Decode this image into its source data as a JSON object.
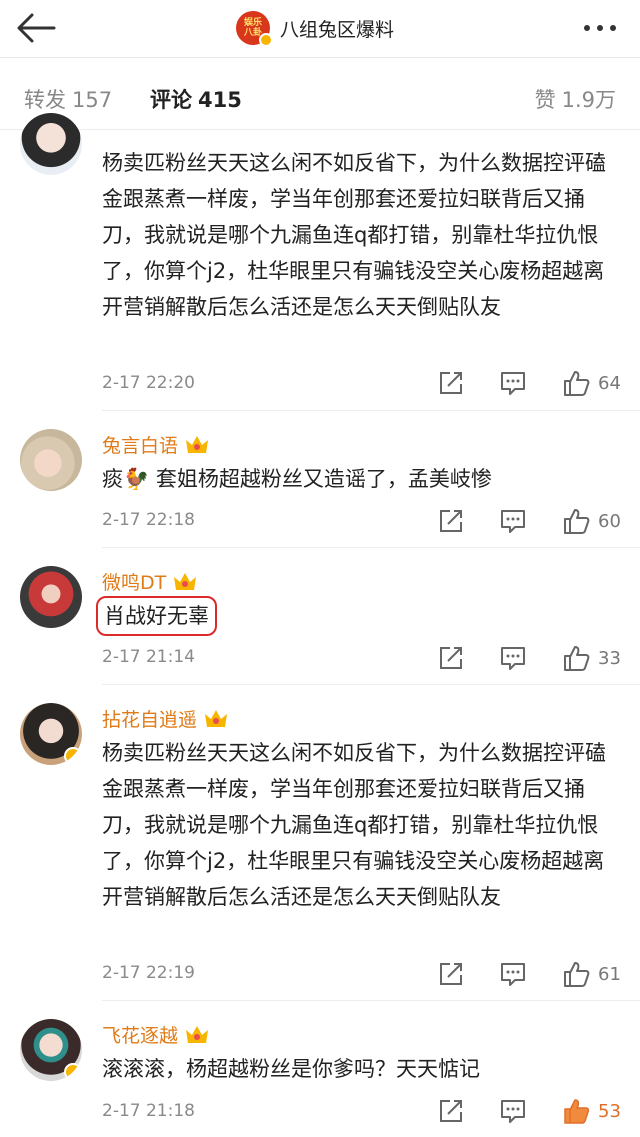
{
  "header": {
    "title": "八组兔区爆料",
    "avatar_text_line1": "娱乐",
    "avatar_text_line2": "八卦"
  },
  "tabs": {
    "repost_label": "转发",
    "repost_count": "157",
    "comments_label": "评论",
    "comments_count": "415",
    "likes_label": "赞",
    "likes_count": "1.9万"
  },
  "comments": [
    {
      "username": "",
      "text": "杨卖匹粉丝天天这么闲不如反省下，为什么数据控评磕金跟蒸煮一样废，学当年创那套还爱拉妇联背后又捅刀，我就说是哪个九漏鱼连q都打错，别靠杜华拉仇恨了，你算个j2，杜华眼里只有骗钱没空关心废杨超越离开营销解散后怎么活还是怎么天天倒贴队友",
      "time": "2-17 22:20",
      "likes": "64"
    },
    {
      "username": "兔言白语",
      "text": "痰🐓 套姐杨超越粉丝又造谣了，孟美岐惨",
      "time": "2-17 22:18",
      "likes": "60"
    },
    {
      "username": "微鸣DT",
      "text": "肖战好无辜",
      "time": "2-17 21:14",
      "likes": "33"
    },
    {
      "username": "拈花自逍遥",
      "text": "杨卖匹粉丝天天这么闲不如反省下，为什么数据控评磕金跟蒸煮一样废，学当年创那套还爱拉妇联背后又捅刀，我就说是哪个九漏鱼连q都打错，别靠杜华拉仇恨了，你算个j2，杜华眼里只有骗钱没空关心废杨超越离开营销解散后怎么活还是怎么天天倒贴队友",
      "time": "2-17 22:19",
      "likes": "61"
    },
    {
      "username": "飞花逐越",
      "text": "滚滚滚，杨超越粉丝是你爹吗？天天惦记",
      "time": "2-17 21:18",
      "likes": "53"
    }
  ],
  "colors": {
    "username": "#e07b19",
    "liked": "#e06f2a",
    "highlight_box": "#d92b2b"
  },
  "icons": [
    "back-arrow-icon",
    "more-icon",
    "share-icon",
    "reply-icon",
    "thumbs-up-icon",
    "crown-badge-icon",
    "verified-badge-icon"
  ]
}
